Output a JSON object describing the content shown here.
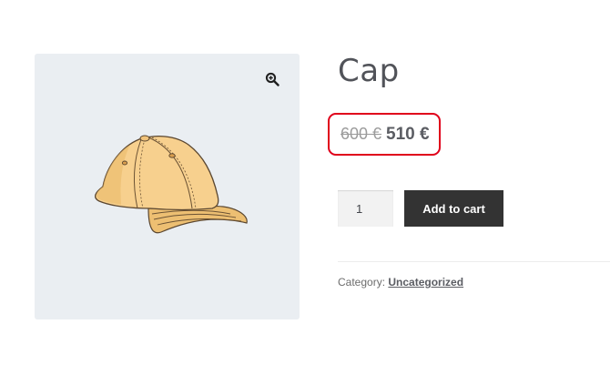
{
  "product": {
    "title": "Cap",
    "price_regular": "600 €",
    "price_sale": "510 €",
    "quantity": "1",
    "add_to_cart_label": "Add to cart",
    "category_label": "Category:",
    "category_value": "Uncategorized",
    "image_icon": "cap-illustration",
    "zoom_icon": "zoom-in-icon"
  },
  "colors": {
    "gallery_background": "#eaeef2",
    "button_background": "#333333",
    "highlight_border": "#e0001b"
  }
}
